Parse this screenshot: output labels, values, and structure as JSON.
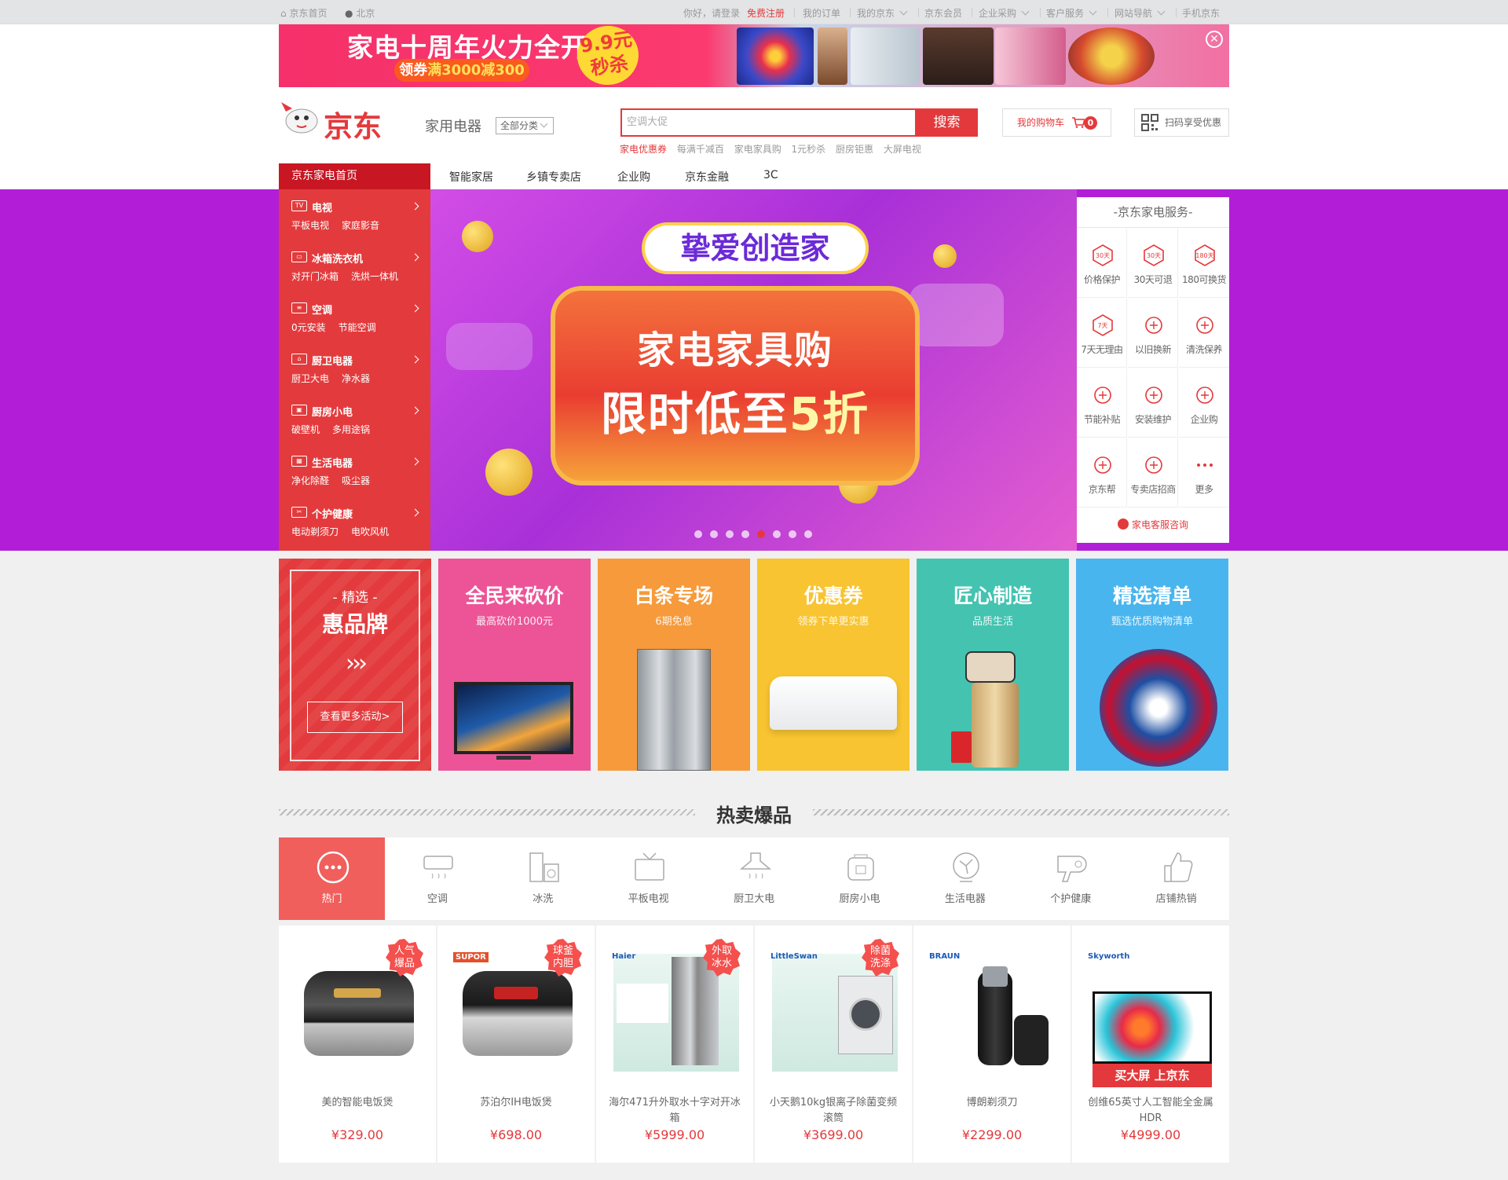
{
  "topbar": {
    "home": "京东首页",
    "location": "北京",
    "login": "你好，请登录",
    "register": "免费注册",
    "links": [
      "我的订单",
      "我的京东",
      "京东会员",
      "企业采购",
      "客户服务",
      "网站导航",
      "手机京东"
    ]
  },
  "ad": {
    "title": "家电十周年火力全开",
    "coupon_prefix": "领券",
    "coupon_value": "满3000减300",
    "flash_price": "9.9元",
    "flash_label": "秒杀"
  },
  "header": {
    "logo": "京东",
    "category_title": "家用电器",
    "category_select": "全部分类",
    "search_placeholder": "空调大促",
    "search_button": "搜索",
    "hotwords": [
      "家电优惠券",
      "每满千减百",
      "家电家具购",
      "1元秒杀",
      "厨房钜惠",
      "大屏电视"
    ],
    "cart_label": "我的购物车",
    "cart_count": "0",
    "qr_label": "扫码享受优惠"
  },
  "nav": {
    "home": "京东家电首页",
    "items": [
      "智能家居",
      "乡镇专卖店",
      "企业购",
      "京东金融",
      "3C"
    ]
  },
  "sidebar": [
    {
      "icon": "tv-icon",
      "glyph": "TV",
      "title": "电视",
      "subs": [
        "平板电视",
        "家庭影音"
      ]
    },
    {
      "icon": "fridge-icon",
      "glyph": "▭",
      "title": "冰箱洗衣机",
      "subs": [
        "对开门冰箱",
        "洗烘一体机"
      ]
    },
    {
      "icon": "aircon-icon",
      "glyph": "≡",
      "title": "空调",
      "subs": [
        "0元安装",
        "节能空调"
      ]
    },
    {
      "icon": "kitchen-icon",
      "glyph": "⌂",
      "title": "厨卫电器",
      "subs": [
        "厨卫大电",
        "净水器"
      ]
    },
    {
      "icon": "small-appliance-icon",
      "glyph": "▣",
      "title": "厨房小电",
      "subs": [
        "破壁机",
        "多用途锅"
      ]
    },
    {
      "icon": "life-appliance-icon",
      "glyph": "▦",
      "title": "生活电器",
      "subs": [
        "净化除醛",
        "吸尘器"
      ]
    },
    {
      "icon": "health-icon",
      "glyph": "✂",
      "title": "个护健康",
      "subs": [
        "电动剃须刀",
        "电吹风机"
      ]
    }
  ],
  "hero": {
    "slogan": "挚爱创造家",
    "line1": "家电家具购",
    "line2_prefix": "限时低至",
    "line2_value": "5折",
    "slide_count": 8,
    "active_slide": 5
  },
  "service": {
    "title": "-京东家电服务-",
    "items": [
      {
        "label": "价格保护",
        "icon": "price-protect-icon",
        "mark": "30天"
      },
      {
        "label": "30天可退",
        "icon": "return-30-icon",
        "mark": "30天"
      },
      {
        "label": "180可换货",
        "icon": "exchange-180-icon",
        "mark": "180天"
      },
      {
        "label": "7天无理由",
        "icon": "seven-day-icon",
        "mark": "7天"
      },
      {
        "label": "以旧换新",
        "icon": "trade-in-icon",
        "mark": ""
      },
      {
        "label": "清洗保养",
        "icon": "cleaning-icon",
        "mark": ""
      },
      {
        "label": "节能补贴",
        "icon": "energy-subsidy-icon",
        "mark": ""
      },
      {
        "label": "安装维护",
        "icon": "install-icon",
        "mark": ""
      },
      {
        "label": "企业购",
        "icon": "enterprise-icon",
        "mark": ""
      },
      {
        "label": "京东帮",
        "icon": "jd-help-icon",
        "mark": ""
      },
      {
        "label": "专卖店招商",
        "icon": "store-icon",
        "mark": ""
      },
      {
        "label": "更多",
        "icon": "more-icon",
        "mark": ""
      }
    ],
    "footer": "家电客服咨询"
  },
  "brand_box": {
    "kicker": "- 精选 -",
    "title": "惠品牌",
    "arrows": "›››",
    "button": "查看更多活动>"
  },
  "promos": [
    {
      "title": "全民来砍价",
      "subtitle": "最高砍价1000元",
      "color": "#ec5497",
      "product": "tv"
    },
    {
      "title": "白条专场",
      "subtitle": "6期免息",
      "color": "#f69a3b",
      "product": "fridge"
    },
    {
      "title": "优惠券",
      "subtitle": "领券下单更实惠",
      "color": "#f8c431",
      "product": "aircon"
    },
    {
      "title": "匠心制造",
      "subtitle": "品质生活",
      "color": "#44c3b0",
      "product": "juicer"
    },
    {
      "title": "精选清单",
      "subtitle": "甄选优质购物清单",
      "color": "#49b5ee",
      "product": "robot"
    }
  ],
  "hot": {
    "title": "热卖爆品",
    "tabs": [
      {
        "label": "热门",
        "icon": "hot-icon",
        "active": true
      },
      {
        "label": "空调",
        "icon": "aircon-icon",
        "active": false
      },
      {
        "label": "冰洗",
        "icon": "washer-icon",
        "active": false
      },
      {
        "label": "平板电视",
        "icon": "tv-icon",
        "active": false
      },
      {
        "label": "厨卫大电",
        "icon": "range-hood-icon",
        "active": false
      },
      {
        "label": "厨房小电",
        "icon": "rice-cooker-icon",
        "active": false
      },
      {
        "label": "生活电器",
        "icon": "fan-icon",
        "active": false
      },
      {
        "label": "个护健康",
        "icon": "hair-dryer-icon",
        "active": false
      },
      {
        "label": "店铺热销",
        "icon": "thumb-up-icon",
        "active": false
      }
    ],
    "products": [
      {
        "name": "美的智能电饭煲",
        "price": "¥329.00",
        "badge": "人气爆品",
        "kind": "cooker-dark",
        "brand": ""
      },
      {
        "name": "苏泊尔IH电饭煲",
        "price": "¥698.00",
        "badge": "球釜内胆",
        "kind": "cooker-silver",
        "brand": "SUPOR"
      },
      {
        "name": "海尔471升外取水十字对开冰箱",
        "price": "¥5999.00",
        "badge": "外取冰水",
        "kind": "fridge",
        "brand": "Haier"
      },
      {
        "name": "小天鹅10kg银离子除菌变频滚筒",
        "price": "¥3699.00",
        "badge": "除菌洗涤",
        "kind": "washer",
        "brand": "LittleSwan"
      },
      {
        "name": "博朗剃须刀",
        "price": "¥2299.00",
        "badge": "",
        "kind": "shaver",
        "brand": "BRAUN"
      },
      {
        "name": "创维65英寸人工智能全金属HDR",
        "price": "¥4999.00",
        "badge": "",
        "kind": "tv",
        "brand": "Skyworth",
        "banner": "买大屏 上京东"
      }
    ]
  },
  "colors": {
    "jd_red": "#e4393c",
    "sidebar_red": "#e33b3d",
    "hero_purple": "#b21ed8",
    "tab_active": "#f05f5c"
  }
}
